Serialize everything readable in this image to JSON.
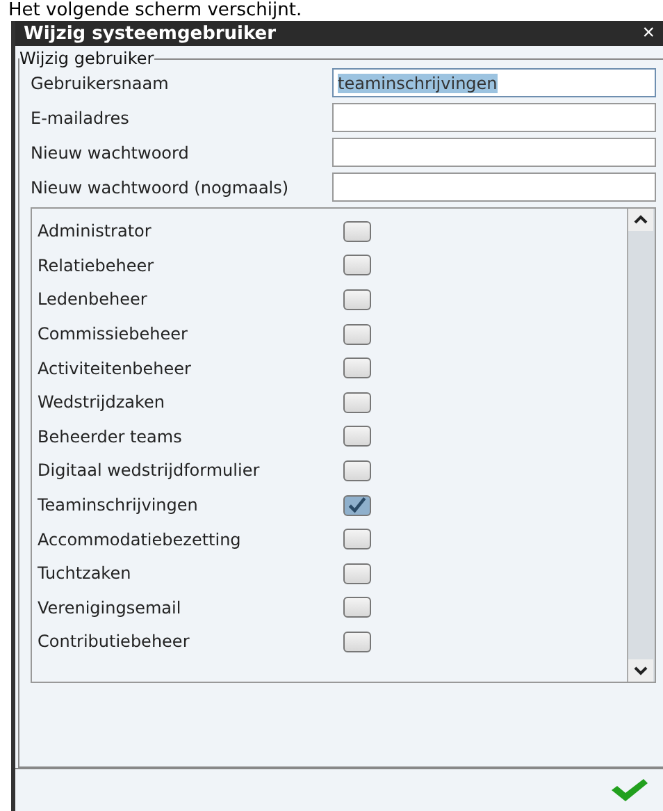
{
  "caption": "Het volgende scherm verschijnt.",
  "window": {
    "title": "Wijzig systeemgebruiker",
    "close": "×"
  },
  "group": {
    "legend": "Wijzig gebruiker"
  },
  "fields": [
    {
      "label": "Gebruikersnaam",
      "value": "teaminschrijvingen",
      "selected": true
    },
    {
      "label": "E-mailadres",
      "selected": false
    },
    {
      "label": "Nieuw wachtwoord",
      "selected": false
    },
    {
      "label": "Nieuw wachtwoord (nogmaals)",
      "selected": false
    }
  ],
  "roles": [
    {
      "label": "Administrator",
      "checked": false
    },
    {
      "label": "Relatiebeheer",
      "checked": false
    },
    {
      "label": "Ledenbeheer",
      "checked": false
    },
    {
      "label": "Commissiebeheer",
      "checked": false
    },
    {
      "label": "Activiteitenbeheer",
      "checked": false
    },
    {
      "label": "Wedstrijdzaken",
      "checked": false
    },
    {
      "label": "Beheerder teams",
      "checked": false
    },
    {
      "label": "Digitaal wedstrijdformulier",
      "checked": false
    },
    {
      "label": "Teaminschrijvingen",
      "checked": true
    },
    {
      "label": "Accommodatiebezetting",
      "checked": false
    },
    {
      "label": "Tuchtzaken",
      "checked": false
    },
    {
      "label": "Verenigingsemail",
      "checked": false
    },
    {
      "label": "Contributiebeheer",
      "checked": false
    }
  ]
}
